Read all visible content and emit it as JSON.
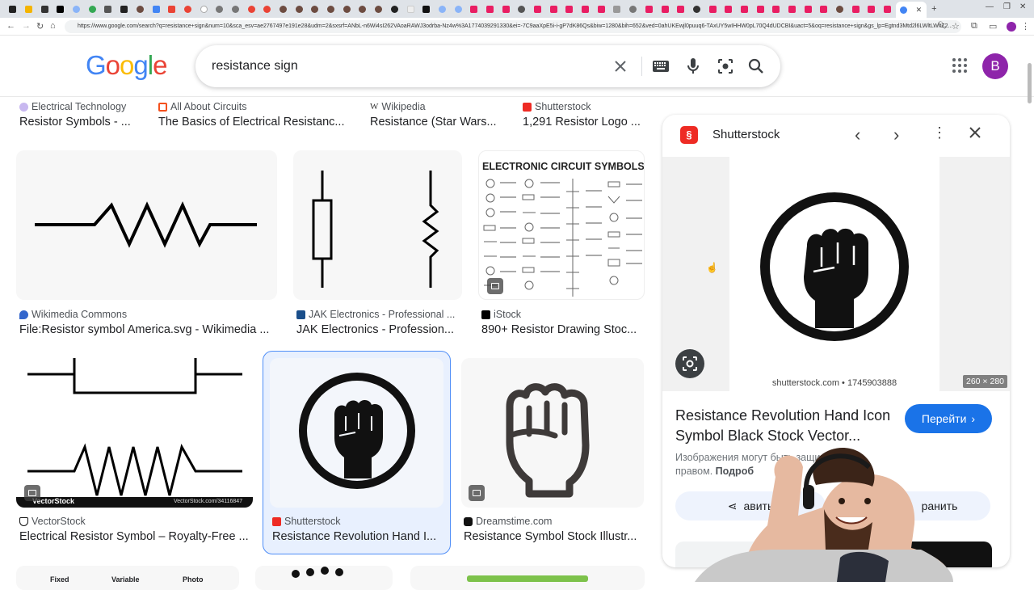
{
  "browser": {
    "url": "https://www.google.com/search?q=resistance+sign&num=10&sca_esv=ae2767497e191e28&udm=2&sxsrf=ANbL-n6Wi4sI262VAoaRAWJ3odrba-Nz4w%3A1774039291330&ei=-7C9aaXpE5i-i-gP7dK86Qs&biw=1280&bih=652&ved=0ahUKEwjl0puuq6-TAxUY5wIHHW0pL70Q4dUDCBI&uact=5&oq=resistance+sign&gs_lp=Egtnd3Mtd2l6LWltLWltZ2..."
  },
  "header": {
    "logo": "Google",
    "search_value": "resistance sign",
    "avatar_letter": "B"
  },
  "top_row": [
    {
      "source": "Electrical Technology",
      "title": "Resistor Symbols - ..."
    },
    {
      "source": "All About Circuits",
      "title": "The Basics of Electrical Resistanc..."
    },
    {
      "source": "Wikipedia",
      "title": "Resistance (Star Wars..."
    },
    {
      "source": "Shutterstock",
      "title": "1,291 Resistor Logo ..."
    }
  ],
  "row2": [
    {
      "source": "Wikimedia Commons",
      "title": "File:Resistor symbol America.svg - Wikimedia ..."
    },
    {
      "source": "JAK Electronics - Professional ...",
      "title": "JAK Electronics - Profession..."
    },
    {
      "source": "iStock",
      "title": "890+ Resistor Drawing Stoc...",
      "image_text": "ELECTRONIC CIRCUIT SYMBOLS"
    }
  ],
  "row3": [
    {
      "source": "VectorStock",
      "title": "Electrical Resistor Symbol – Royalty-Free ...",
      "watermark": "VectorStock",
      "watermark2": "VectorStock.com/34116847"
    },
    {
      "source": "Shutterstock",
      "title": "Resistance Revolution Hand I..."
    },
    {
      "source": "Dreamstime.com",
      "title": "Resistance Symbol Stock Illustr..."
    }
  ],
  "row4": {
    "labels": [
      "Fixed",
      "Variable",
      "Photo"
    ]
  },
  "panel": {
    "source": "Shutterstock",
    "image_caption": "shutterstock.com • 1745903888",
    "dimensions": "260 × 280",
    "title_line1": "Resistance Revolution Hand Icon",
    "title_line2": "Symbol Black Stock Vector...",
    "visit_label": "Перейти",
    "notice_line1": "Изображения могут быть защищены а",
    "notice_line2_a": "правом. ",
    "notice_line2_b": "Подроб",
    "share_label": "авить",
    "save_label": "ранить"
  },
  "colors": {
    "accent": "#1a73e8",
    "avatar": "#8e24aa",
    "shutterstock": "#ee2b24"
  }
}
